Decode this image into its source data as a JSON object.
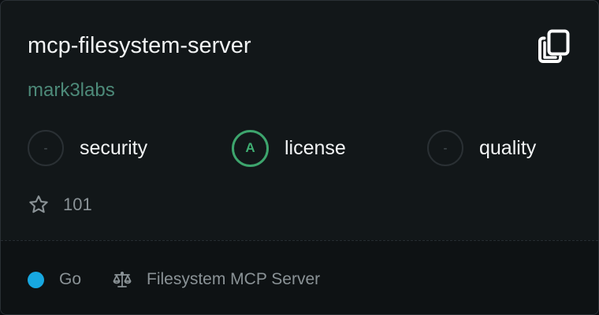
{
  "repo": {
    "name": "mcp-filesystem-server",
    "owner": "mark3labs"
  },
  "scores": [
    {
      "grade": "-",
      "label": "security"
    },
    {
      "grade": "A",
      "label": "license"
    },
    {
      "grade": "-",
      "label": "quality"
    }
  ],
  "stars": {
    "count": "101",
    "icon": "star-outline-icon"
  },
  "footer": {
    "language": "Go",
    "language_color": "#17a7e0",
    "license_name": "Filesystem MCP Server",
    "license_icon": "scale-icon"
  },
  "colors": {
    "owner": "#4d8a79",
    "grade_a": "#3da56d"
  },
  "actions": {
    "copy_icon": "copy-icon"
  }
}
